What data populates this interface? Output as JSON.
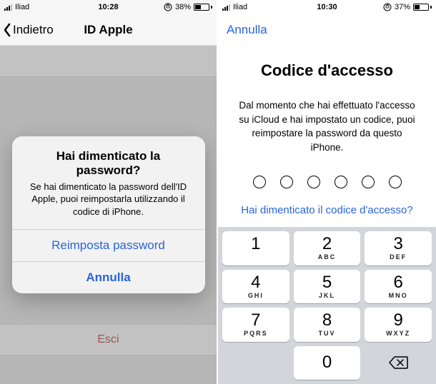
{
  "left": {
    "status": {
      "carrier": "Iliad",
      "time": "10:28",
      "battery_pct": "38%"
    },
    "nav": {
      "back": "Indietro",
      "title": "ID Apple"
    },
    "signout": "Esci",
    "alert": {
      "title": "Hai dimenticato la password?",
      "message": "Se hai dimenticato la password dell'ID Apple, puoi reimpostarla utilizzando il codice di iPhone.",
      "primary": "Reimposta password",
      "cancel": "Annulla"
    }
  },
  "right": {
    "status": {
      "carrier": "Iliad",
      "time": "10:30",
      "battery_pct": "37%"
    },
    "nav": {
      "cancel": "Annulla"
    },
    "passcode": {
      "title": "Codice d'accesso",
      "desc": "Dal momento che hai effettuato l'accesso su iCloud e hai impostato un codice, puoi reimpostare la password da questo iPhone.",
      "forgot": "Hai dimenticato il codice d'accesso?"
    },
    "keypad": {
      "k1": "1",
      "k2": "2",
      "k2l": "ABC",
      "k3": "3",
      "k3l": "DEF",
      "k4": "4",
      "k4l": "GHI",
      "k5": "5",
      "k5l": "JKL",
      "k6": "6",
      "k6l": "MNO",
      "k7": "7",
      "k7l": "PQRS",
      "k8": "8",
      "k8l": "TUV",
      "k9": "9",
      "k9l": "WXYZ",
      "k0": "0"
    }
  }
}
